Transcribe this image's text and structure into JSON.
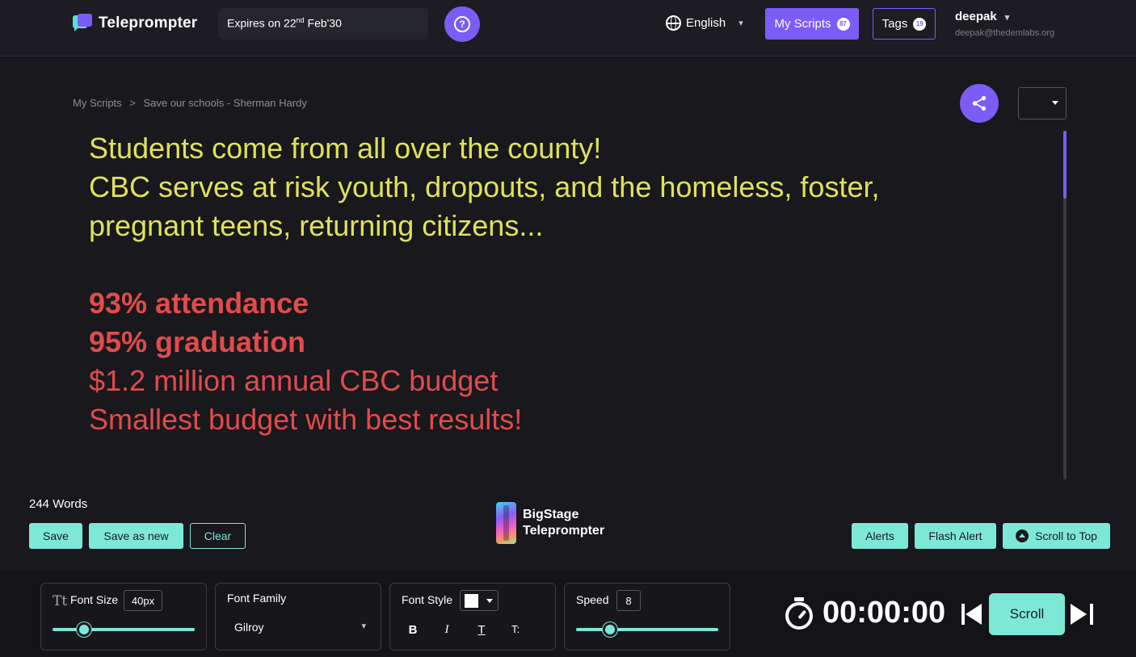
{
  "header": {
    "app_name": "Teleprompter",
    "expiry_prefix": "Expires on 22",
    "expiry_sup": "nd",
    "expiry_suffix": " Feb'30",
    "help_label": "?",
    "language": "English",
    "my_scripts_label": "My Scripts",
    "my_scripts_count": "87",
    "tags_label": "Tags",
    "tags_count": "19",
    "user_name": "deepak",
    "user_email": "deepak@thedemlabs.org"
  },
  "breadcrumb": {
    "root": "My Scripts",
    "separator": ">",
    "current": "Save our schools - Sherman Hardy"
  },
  "script": {
    "lines_yellow": [
      "Students come from all over the county!",
      "CBC serves at risk youth, dropouts, and the homeless, foster,",
      "pregnant teens, returning citizens..."
    ],
    "lines_red_bold": [
      "93% attendance",
      "95% graduation"
    ],
    "lines_red": [
      "$1.2 million annual CBC budget",
      "Smallest budget with best results!"
    ]
  },
  "editor": {
    "word_count": "244 Words",
    "save_label": "Save",
    "save_as_new_label": "Save as new",
    "clear_label": "Clear",
    "alerts_label": "Alerts",
    "flash_alert_label": "Flash Alert",
    "scroll_to_top_label": "Scroll to Top"
  },
  "brand": {
    "line1": "BigStage",
    "line2": "Teleprompter"
  },
  "controls": {
    "font_size_label": "Font Size",
    "font_size_value": "40px",
    "font_size_slider": 0.22,
    "font_family_label": "Font Family",
    "font_family_value": "Gilroy",
    "font_style_label": "Font Style",
    "font_color": "#ffffff",
    "style_bold": "B",
    "style_italic": "I",
    "style_underline": "T",
    "style_caps": "T:",
    "speed_label": "Speed",
    "speed_value": "8",
    "speed_slider": 0.24,
    "timer": "00:00:00",
    "scroll_label": "Scroll"
  },
  "colors": {
    "accent_purple": "#7b5cf5",
    "accent_mint": "#7ee8d6",
    "text_yellow": "#e1e15a",
    "text_red": "#e24b4b"
  },
  "icons": [
    "globe-icon",
    "help-icon",
    "share-icon",
    "chevron-down-icon",
    "timer-icon",
    "skip-previous-icon",
    "skip-next-icon",
    "arrow-up-icon",
    "text-size-icon"
  ]
}
